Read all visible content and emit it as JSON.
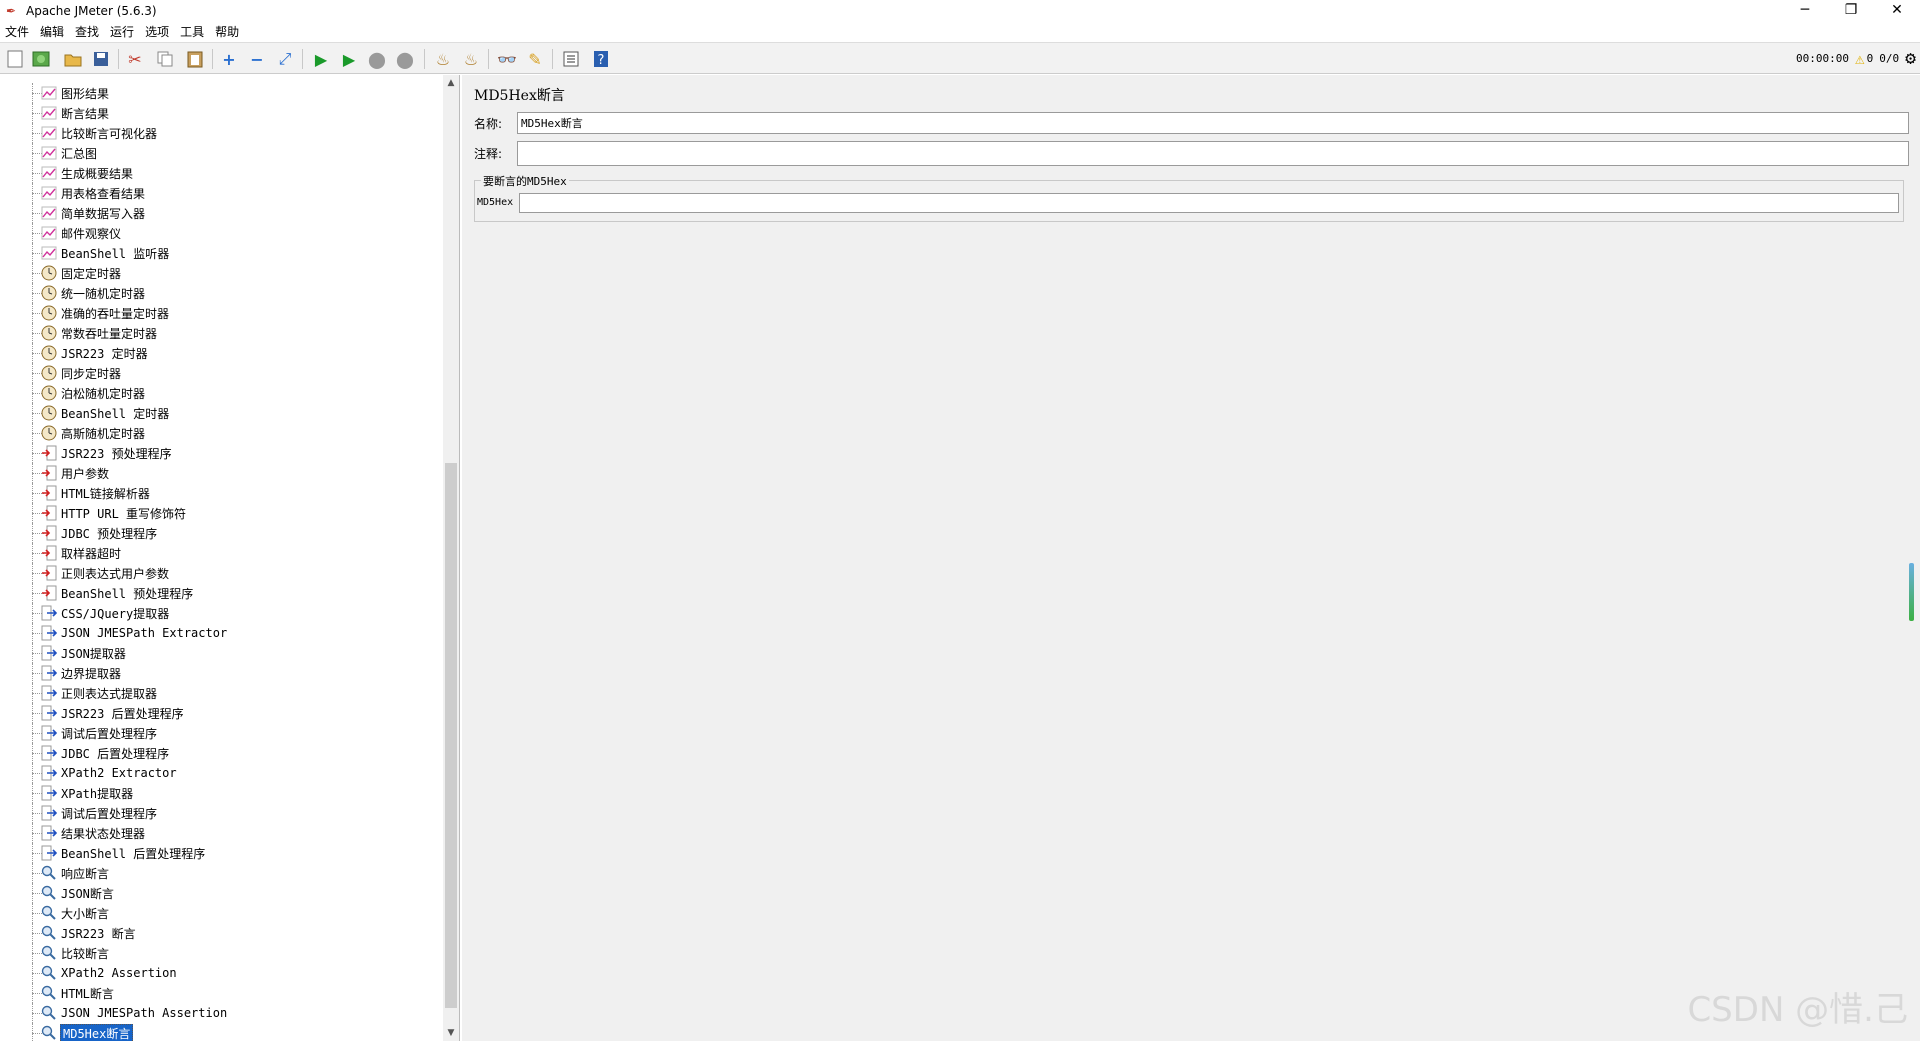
{
  "window": {
    "title": "Apache JMeter (5.6.3)",
    "minimize": "─",
    "maximize": "❐",
    "close": "✕"
  },
  "menu": [
    "文件",
    "编辑",
    "查找",
    "运行",
    "选项",
    "工具",
    "帮助"
  ],
  "status": {
    "timer": "00:00:00",
    "warnings": "0",
    "threads": "0/0"
  },
  "tree": [
    {
      "label": "图形结果",
      "icon": "listener-graph-icon"
    },
    {
      "label": "断言结果",
      "icon": "listener-graph-icon"
    },
    {
      "label": "比较断言可视化器",
      "icon": "listener-graph-icon"
    },
    {
      "label": "汇总图",
      "icon": "listener-graph-icon"
    },
    {
      "label": "生成概要结果",
      "icon": "listener-graph-icon"
    },
    {
      "label": "用表格查看结果",
      "icon": "listener-graph-icon"
    },
    {
      "label": "简单数据写入器",
      "icon": "listener-graph-icon"
    },
    {
      "label": "邮件观察仪",
      "icon": "listener-graph-icon"
    },
    {
      "label": "BeanShell 监听器",
      "icon": "listener-graph-icon"
    },
    {
      "label": "固定定时器",
      "icon": "timer-clock-icon"
    },
    {
      "label": "统一随机定时器",
      "icon": "timer-clock-icon"
    },
    {
      "label": "准确的吞吐量定时器",
      "icon": "timer-clock-icon"
    },
    {
      "label": "常数吞吐量定时器",
      "icon": "timer-clock-icon"
    },
    {
      "label": "JSR223 定时器",
      "icon": "timer-clock-icon"
    },
    {
      "label": "同步定时器",
      "icon": "timer-clock-icon"
    },
    {
      "label": "泊松随机定时器",
      "icon": "timer-clock-icon"
    },
    {
      "label": "BeanShell 定时器",
      "icon": "timer-clock-icon"
    },
    {
      "label": "高斯随机定时器",
      "icon": "timer-clock-icon"
    },
    {
      "label": "JSR223 预处理程序",
      "icon": "preprocessor-icon"
    },
    {
      "label": "用户参数",
      "icon": "preprocessor-icon"
    },
    {
      "label": "HTML链接解析器",
      "icon": "preprocessor-icon"
    },
    {
      "label": "HTTP URL 重写修饰符",
      "icon": "preprocessor-icon"
    },
    {
      "label": "JDBC 预处理程序",
      "icon": "preprocessor-icon"
    },
    {
      "label": "取样器超时",
      "icon": "preprocessor-icon"
    },
    {
      "label": "正则表达式用户参数",
      "icon": "preprocessor-icon"
    },
    {
      "label": "BeanShell 预处理程序",
      "icon": "preprocessor-icon"
    },
    {
      "label": "CSS/JQuery提取器",
      "icon": "postprocessor-icon"
    },
    {
      "label": "JSON JMESPath Extractor",
      "icon": "postprocessor-icon"
    },
    {
      "label": "JSON提取器",
      "icon": "postprocessor-icon"
    },
    {
      "label": "边界提取器",
      "icon": "postprocessor-icon"
    },
    {
      "label": "正则表达式提取器",
      "icon": "postprocessor-icon"
    },
    {
      "label": "JSR223 后置处理程序",
      "icon": "postprocessor-icon"
    },
    {
      "label": "调试后置处理程序",
      "icon": "postprocessor-icon"
    },
    {
      "label": "JDBC 后置处理程序",
      "icon": "postprocessor-icon"
    },
    {
      "label": "XPath2 Extractor",
      "icon": "postprocessor-icon"
    },
    {
      "label": "XPath提取器",
      "icon": "postprocessor-icon"
    },
    {
      "label": "调试后置处理程序",
      "icon": "postprocessor-icon"
    },
    {
      "label": "结果状态处理器",
      "icon": "postprocessor-icon"
    },
    {
      "label": "BeanShell 后置处理程序",
      "icon": "postprocessor-icon"
    },
    {
      "label": "响应断言",
      "icon": "assertion-magnifier-icon"
    },
    {
      "label": "JSON断言",
      "icon": "assertion-magnifier-icon"
    },
    {
      "label": "大小断言",
      "icon": "assertion-magnifier-icon"
    },
    {
      "label": "JSR223 断言",
      "icon": "assertion-magnifier-icon"
    },
    {
      "label": "比较断言",
      "icon": "assertion-magnifier-icon"
    },
    {
      "label": "XPath2 Assertion",
      "icon": "assertion-magnifier-icon"
    },
    {
      "label": "HTML断言",
      "icon": "assertion-magnifier-icon"
    },
    {
      "label": "JSON JMESPath Assertion",
      "icon": "assertion-magnifier-icon"
    },
    {
      "label": "MD5Hex断言",
      "icon": "assertion-magnifier-icon",
      "selected": true
    }
  ],
  "panel": {
    "heading": "MD5Hex断言",
    "name_label": "名称:",
    "name_value": "MD5Hex断言",
    "comment_label": "注释:",
    "comment_value": "",
    "group_title": "要断言的MD5Hex",
    "md5_label": "MD5Hex",
    "md5_value": ""
  },
  "watermark": "CSDN @惜.己",
  "colors": {
    "selection": "#1764c8",
    "panel_bg": "#f0f0f0"
  }
}
